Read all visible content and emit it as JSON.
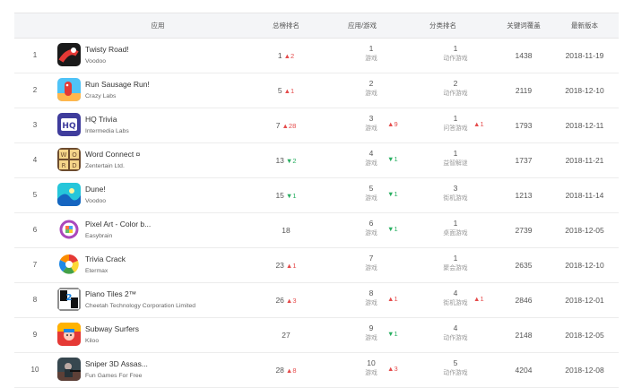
{
  "headers": {
    "app": "应用",
    "total_rank": "总榜排名",
    "app_game": "应用/游戏",
    "category_rank": "分类排名",
    "keyword_count": "关键词覆盖",
    "latest_version": "最新版本"
  },
  "colors": {
    "up": "#e54b4b",
    "down": "#27ae60"
  },
  "rows": [
    {
      "rank": "1",
      "name": "Twisty Road!",
      "developer": "Voodoo",
      "icon": "twisty-road-icon",
      "total": "1",
      "total_dir": "up",
      "total_chg": "2",
      "app_game_num": "1",
      "app_game_label": "游戏",
      "ag_dir": "",
      "ag_chg": "",
      "cat_num": "1",
      "cat_label": "动作游戏",
      "cat_dir": "",
      "cat_chg": "",
      "keywords": "1438",
      "date": "2018-11-19"
    },
    {
      "rank": "2",
      "name": "Run Sausage Run!",
      "developer": "Crazy Labs",
      "icon": "run-sausage-run-icon",
      "total": "5",
      "total_dir": "up",
      "total_chg": "1",
      "app_game_num": "2",
      "app_game_label": "游戏",
      "ag_dir": "",
      "ag_chg": "",
      "cat_num": "2",
      "cat_label": "动作游戏",
      "cat_dir": "",
      "cat_chg": "",
      "keywords": "2119",
      "date": "2018-12-10"
    },
    {
      "rank": "3",
      "name": "HQ Trivia",
      "developer": "Intermedia Labs",
      "icon": "hq-trivia-icon",
      "total": "7",
      "total_dir": "up",
      "total_chg": "28",
      "app_game_num": "3",
      "app_game_label": "游戏",
      "ag_dir": "up",
      "ag_chg": "9",
      "cat_num": "1",
      "cat_label": "问答游戏",
      "cat_dir": "up",
      "cat_chg": "1",
      "keywords": "1793",
      "date": "2018-12-11"
    },
    {
      "rank": "4",
      "name": "Word Connect ¤",
      "developer": "Zentertain Ltd.",
      "icon": "word-connect-icon",
      "total": "13",
      "total_dir": "down",
      "total_chg": "2",
      "app_game_num": "4",
      "app_game_label": "游戏",
      "ag_dir": "down",
      "ag_chg": "1",
      "cat_num": "1",
      "cat_label": "益智解谜",
      "cat_dir": "",
      "cat_chg": "",
      "keywords": "1737",
      "date": "2018-11-21"
    },
    {
      "rank": "5",
      "name": "Dune!",
      "developer": "Voodoo",
      "icon": "dune-icon",
      "total": "15",
      "total_dir": "down",
      "total_chg": "1",
      "app_game_num": "5",
      "app_game_label": "游戏",
      "ag_dir": "down",
      "ag_chg": "1",
      "cat_num": "3",
      "cat_label": "街机游戏",
      "cat_dir": "",
      "cat_chg": "",
      "keywords": "1213",
      "date": "2018-11-14"
    },
    {
      "rank": "6",
      "name": "Pixel Art - Color b...",
      "developer": "Easybrain",
      "icon": "pixel-art-icon",
      "total": "18",
      "total_dir": "",
      "total_chg": "",
      "app_game_num": "6",
      "app_game_label": "游戏",
      "ag_dir": "down",
      "ag_chg": "1",
      "cat_num": "1",
      "cat_label": "桌面游戏",
      "cat_dir": "",
      "cat_chg": "",
      "keywords": "2739",
      "date": "2018-12-05"
    },
    {
      "rank": "7",
      "name": "Trivia Crack",
      "developer": "Etermax",
      "icon": "trivia-crack-icon",
      "total": "23",
      "total_dir": "up",
      "total_chg": "1",
      "app_game_num": "7",
      "app_game_label": "游戏",
      "ag_dir": "",
      "ag_chg": "",
      "cat_num": "1",
      "cat_label": "聚会游戏",
      "cat_dir": "",
      "cat_chg": "",
      "keywords": "2635",
      "date": "2018-12-10"
    },
    {
      "rank": "8",
      "name": "Piano Tiles 2™",
      "developer": "Cheetah Technology Corporation Limited",
      "icon": "piano-tiles-icon",
      "total": "26",
      "total_dir": "up",
      "total_chg": "3",
      "app_game_num": "8",
      "app_game_label": "游戏",
      "ag_dir": "up",
      "ag_chg": "1",
      "cat_num": "4",
      "cat_label": "街机游戏",
      "cat_dir": "up",
      "cat_chg": "1",
      "keywords": "2846",
      "date": "2018-12-01"
    },
    {
      "rank": "9",
      "name": "Subway Surfers",
      "developer": "Kiloo",
      "icon": "subway-surfers-icon",
      "total": "27",
      "total_dir": "",
      "total_chg": "",
      "app_game_num": "9",
      "app_game_label": "游戏",
      "ag_dir": "down",
      "ag_chg": "1",
      "cat_num": "4",
      "cat_label": "动作游戏",
      "cat_dir": "",
      "cat_chg": "",
      "keywords": "2148",
      "date": "2018-12-05"
    },
    {
      "rank": "10",
      "name": "Sniper 3D Assas...",
      "developer": "Fun Games For Free",
      "icon": "sniper-3d-icon",
      "total": "28",
      "total_dir": "up",
      "total_chg": "8",
      "app_game_num": "10",
      "app_game_label": "游戏",
      "ag_dir": "up",
      "ag_chg": "3",
      "cat_num": "5",
      "cat_label": "动作游戏",
      "cat_dir": "",
      "cat_chg": "",
      "keywords": "4204",
      "date": "2018-12-08"
    }
  ]
}
